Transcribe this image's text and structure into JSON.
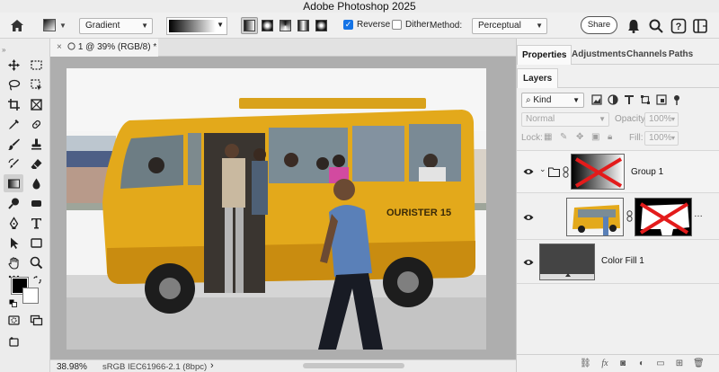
{
  "app": {
    "title": "Adobe Photoshop 2025"
  },
  "options_bar": {
    "gradient_mode": "Gradient",
    "reverse_label": "Reverse",
    "reverse_checked": true,
    "dither_label": "Dither",
    "dither_checked": false,
    "method_label": "Method:",
    "method_value": "Perceptual",
    "share_label": "Share"
  },
  "document": {
    "tab_title": "1 @ 39% (RGB/8) *",
    "photo_sign_text": "OURISTER  15"
  },
  "status": {
    "zoom": "38.98%",
    "profile": "sRGB IEC61966-2.1 (8bpc)"
  },
  "panels": {
    "tabs": [
      "Properties",
      "Adjustments",
      "Channels",
      "Paths"
    ],
    "layers_tab": "Layers",
    "kind_filter": "Kind",
    "blend_mode": "Normal",
    "opacity_label": "Opacity:",
    "opacity_value": "100%",
    "lock_label": "Lock:",
    "fill_label": "Fill:",
    "fill_value": "100%",
    "layers": [
      {
        "name": "Group 1"
      },
      {
        "name": ""
      },
      {
        "name": "Color Fill 1"
      }
    ],
    "more_glyph": "…"
  },
  "colors": {
    "accent_blue": "#1473e6",
    "bus_yellow": "#e3a91b",
    "mask_red": "#e31b1b",
    "fill_gray": "#444444"
  },
  "icons": [
    "home-icon",
    "bell-icon",
    "search-icon",
    "help-icon",
    "workspace-icon",
    "eye-icon",
    "folder-icon",
    "link-icon",
    "chevron-down-icon"
  ]
}
